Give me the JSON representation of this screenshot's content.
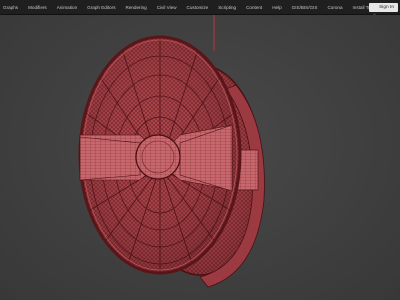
{
  "menubar": {
    "items": [
      {
        "label": "Graphs"
      },
      {
        "label": "Modifiers"
      },
      {
        "label": "Animation"
      },
      {
        "label": "Graph Editors"
      },
      {
        "label": "Rendering"
      },
      {
        "label": "Civil View"
      },
      {
        "label": "Customize"
      },
      {
        "label": "Scripting"
      },
      {
        "label": "Content"
      },
      {
        "label": "Help"
      },
      {
        "label": "GIS/BIS/GIS"
      },
      {
        "label": "Corona"
      },
      {
        "label": "Install Tools"
      }
    ],
    "signin_label": "Sign In",
    "signin_icon": "user-icon"
  },
  "viewport": {
    "object": "3d-wireframe-fan-model",
    "mesh_color": "#b0474b",
    "wire_color": "#5a1518",
    "background_color": "#454545"
  }
}
